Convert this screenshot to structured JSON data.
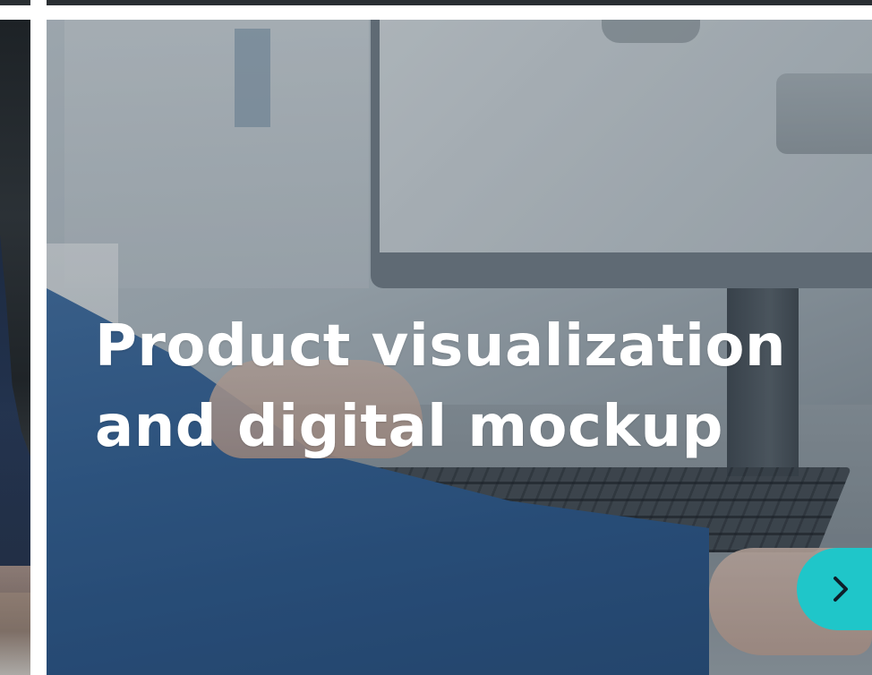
{
  "carousel": {
    "current_card": {
      "title_line_1": "Product visualization",
      "title_line_2": "and digital mockup"
    },
    "next_button": {
      "icon": "chevron-right-icon",
      "color": "#1fc6c9"
    }
  }
}
